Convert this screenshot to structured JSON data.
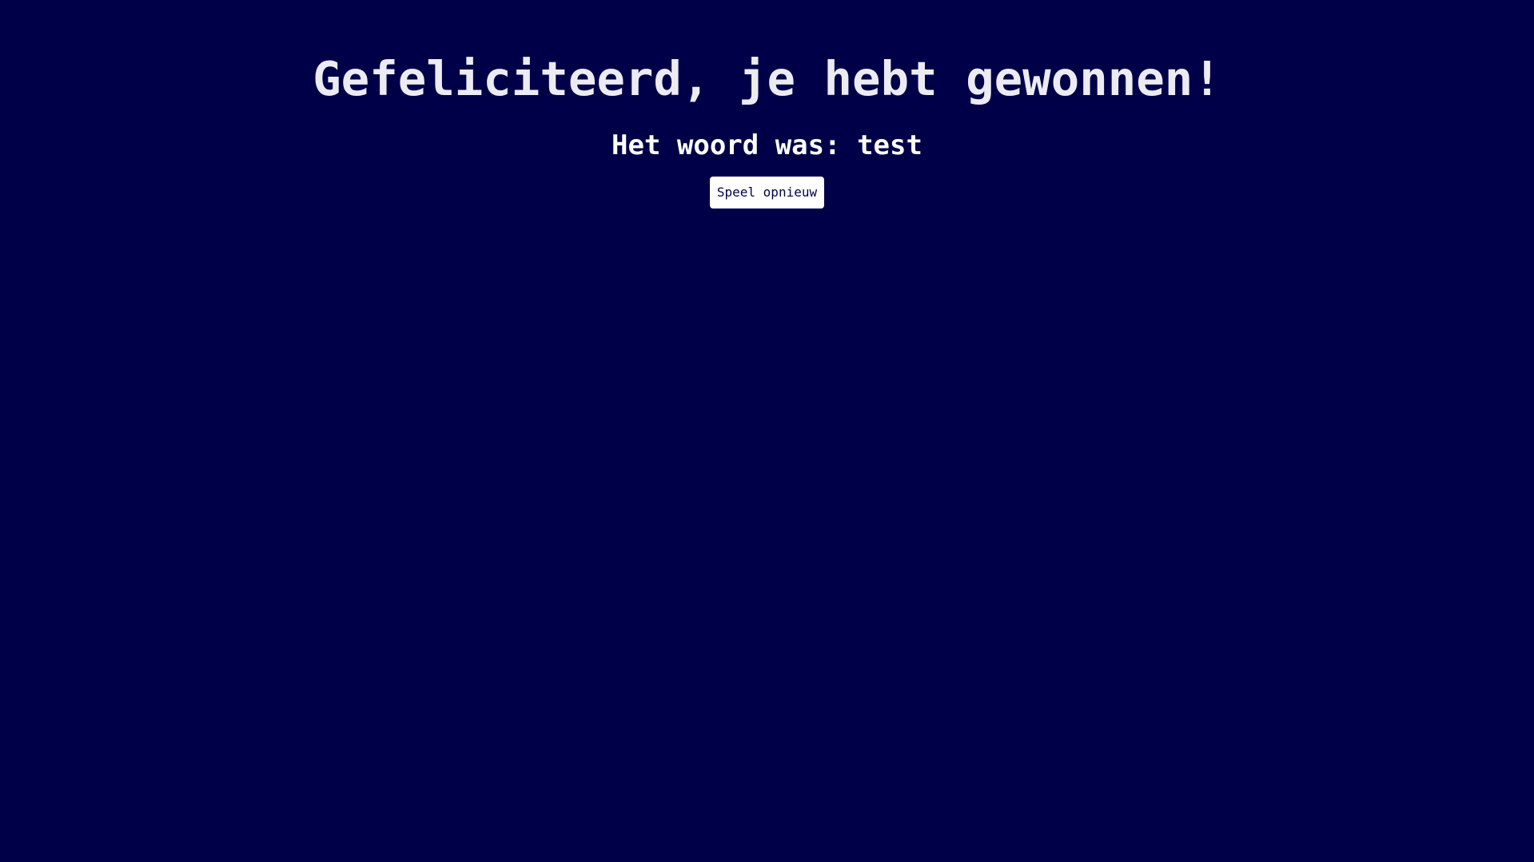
{
  "game": {
    "title": "Gefeliciteerd, je hebt gewonnen!",
    "word_label": "Het woord was:",
    "word": "test",
    "replay_label": "Speel opnieuw"
  },
  "colors": {
    "background": "#000048",
    "text": "#ecebf3",
    "button_background": "#ffffff",
    "button_text": "#000048"
  }
}
